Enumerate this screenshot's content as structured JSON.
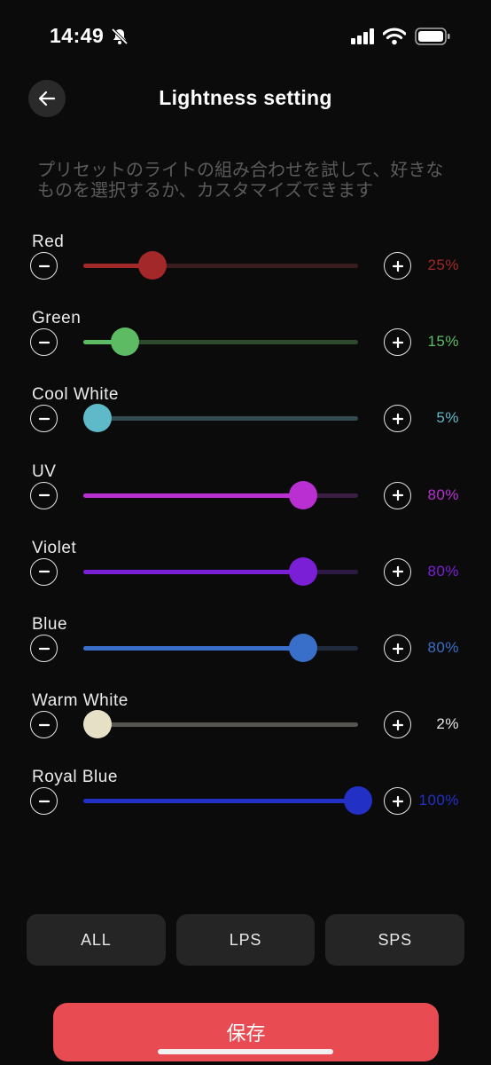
{
  "status_bar": {
    "time": "14:49"
  },
  "header": {
    "title": "Lightness setting"
  },
  "description": "プリセットのライトの組み合わせを試して、好きなものを選択するか、カスタマイズできます",
  "channels": [
    {
      "name": "Red",
      "percent": 25,
      "label": "25%",
      "color": "#a2282a",
      "track_color": "#3a1c1c",
      "label_color": "#a2282a"
    },
    {
      "name": "Green",
      "percent": 15,
      "label": "15%",
      "color": "#5dbb63",
      "track_color": "#2f4a2f",
      "label_color": "#5dbb63"
    },
    {
      "name": "Cool White",
      "percent": 5,
      "label": "5%",
      "color": "#5eb9c8",
      "track_color": "#324b4f",
      "label_color": "#5eb9c8"
    },
    {
      "name": "UV",
      "percent": 80,
      "label": "80%",
      "color": "#b92fd1",
      "track_color": "#3c1d43",
      "label_color": "#b92fd1"
    },
    {
      "name": "Violet",
      "percent": 80,
      "label": "80%",
      "color": "#7a1fd6",
      "track_color": "#2c1a45",
      "label_color": "#7a1fd6"
    },
    {
      "name": "Blue",
      "percent": 80,
      "label": "80%",
      "color": "#3a6fc9",
      "track_color": "#1f2a3d",
      "label_color": "#3a6fc9"
    },
    {
      "name": "Warm White",
      "percent": 2,
      "label": "2%",
      "color": "#e6e0c6",
      "track_color": "#545450",
      "label_color": "#e6e6e6"
    },
    {
      "name": "Royal Blue",
      "percent": 100,
      "label": "100%",
      "color": "#2230c6",
      "track_color": "#1a1f45",
      "label_color": "#2230c6"
    }
  ],
  "presets": [
    "ALL",
    "LPS",
    "SPS"
  ],
  "save_label": "保存"
}
